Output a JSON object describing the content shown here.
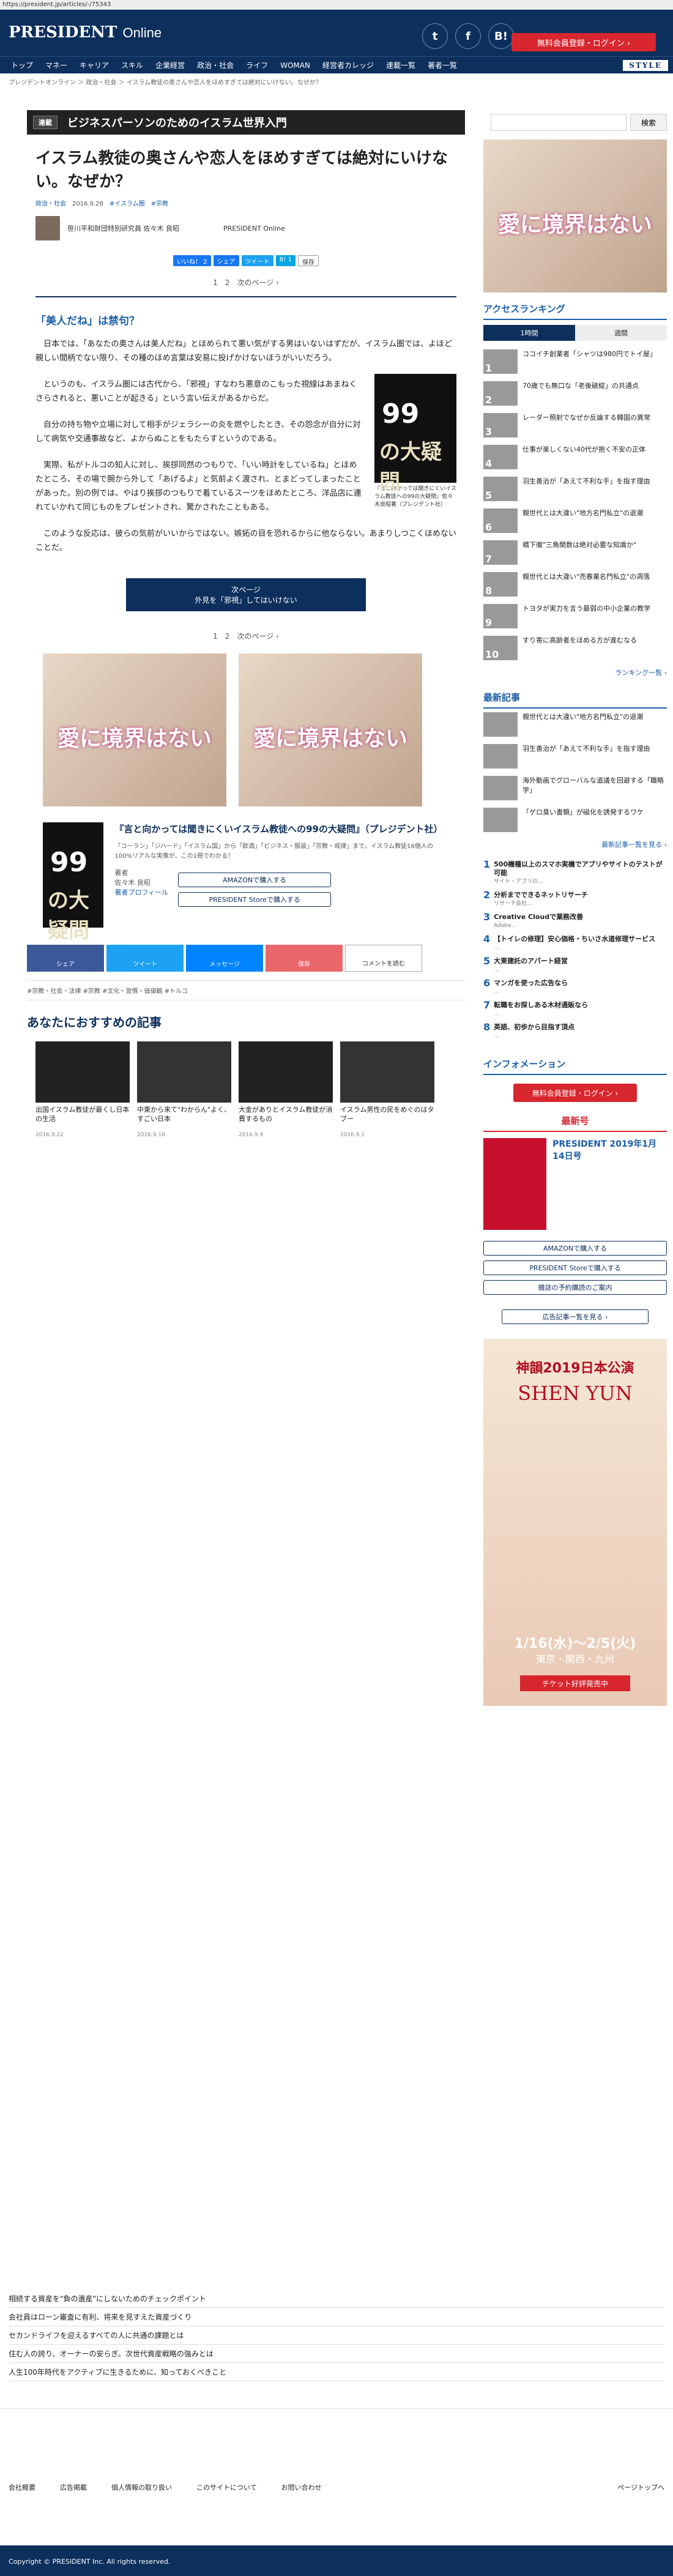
{
  "url": "https://president.jp/articles/-/75343",
  "site": {
    "logo_main": "PRESIDENT",
    "logo_sub": "Online"
  },
  "header": {
    "login_label": "無料会員登録・ログイン ›",
    "icons": [
      "twitter-icon",
      "facebook-icon",
      "hatena-icon"
    ]
  },
  "nav": [
    "トップ",
    "マネー",
    "キャリア",
    "スキル",
    "企業経営",
    "政治・社会",
    "ライフ",
    "WOMAN",
    "経営者カレッジ",
    "連載一覧",
    "著者一覧"
  ],
  "nav_style": "STYLE",
  "breadcrumb": "プレジデントオンライン ＞ 政治・社会 ＞ イスラム教徒の奥さんや恋人をほめすぎては絶対にいけない。なぜか？",
  "series": {
    "tag": "連載",
    "title": "ビジネスパーソンのためのイスラム世界入門"
  },
  "search": {
    "button": "検索"
  },
  "article": {
    "title": "イスラム教徒の奥さんや恋人をほめすぎては絶対にいけない。なぜか？",
    "category": "政治・社会",
    "date": "2016.9.28",
    "tags_inline": "#イスラム圏　#宗教",
    "author": "笹川平和財団特別研究員 佐々木 良昭",
    "publisher": "PRESIDENT Online",
    "share_buttons": [
      "いいね！ 2",
      "シェア",
      "ツイート",
      "B! 1",
      "保存"
    ],
    "pager": "1　2　次のページ ›",
    "subheading": "「美人だね」は禁句？",
    "paragraphs": [
      "日本では、「あなたの奥さんは美人だね」とほめられて悪い気がする男はいないはずだが、イスラム圏では、よほど親しい間柄でない限り、その種のほめ言葉は安易に投げかけないほうがいいだろう。",
      "というのも、イスラム圏には古代から、「邪視」すなわち悪意のこもった視線はあまねくさらされると、悪いことが起きる」という言い伝えがあるからだ。",
      "自分の持ち物や立場に対して相手がジェラシーの炎を燃やしたとき、その怨念が自分に対して病気や交通事故など、よからぬことをもたらすというのである。",
      "実際、私がトルコの知人に対し、挨拶同然のつもりで、「いい時計をしているね」とほめたところ、その場で腕から外して「あげるよ」と気前よく渡され、とまどってしまったことがあった。別の例では、やはり挨拶のつもりで着ているスーツをほめたところ、洋品店に連れていかれて同じものをプレゼントされ、驚かされたこともある。",
      "このような反応は、彼らの気前がいいからではない。嫉妬の目を恐れるからに他ならない。あまりしつこくほめないことだ。"
    ],
    "book_caption": "『言と向かっては聞きにくいイスラム教徒への99の大疑問』佐々木良昭著（プレジデント社）",
    "next": {
      "label": "次ページ",
      "title": "外見を「邪視」してはいけない"
    }
  },
  "ad": {
    "text": "愛に境界はない"
  },
  "book": {
    "title": "『言と向かっては聞きにくいイスラム教徒への99の大疑問』（プレジデント社）",
    "desc": "「コーラン」「ジハード」「イスラム国」から「飲酒」「ビジネス・服装」「宗教・戒律」まで。イスラム教徒16億人の100%リアルな実像が、この1冊でわかる！",
    "author_label": "著者",
    "author": "佐々木 良昭",
    "profile": "著者プロフィール",
    "amazon": "AMAZONで購入する",
    "store": "PRESIDENT Storeで購入する"
  },
  "sharebig": [
    "シェア",
    "ツイート",
    "メッセージ",
    "保存",
    "コメントを読む"
  ],
  "tags": "#宗教・社会・法律 #宗教 #文化・習慣・価値観 #トルコ",
  "recommend_head": "あなたにおすすめの記事",
  "recommend": [
    {
      "title": "出国イスラム教徒が最くし日本の生活",
      "date": "2016.9.22"
    },
    {
      "title": "中東から来て\"わからん\"よく、すごい日本",
      "date": "2016.9.16"
    },
    {
      "title": "大金がありとイスラム教徒が消費するもの",
      "date": "2016.9.9"
    },
    {
      "title": "イスラム男性の民をめぐのはタブー",
      "date": "2016.9.1"
    }
  ],
  "sidebar": {
    "ranking_head": "アクセスランキング",
    "tabs": [
      "1時間",
      "週間"
    ],
    "ranking": [
      "ココイチ創業者「シャツは980円でトイ屋」",
      "70歳でも無口な「老後破綻」の共通点",
      "レーダー照射でなぜか反論する韓国の異常",
      "仕事が楽しくない40代が抱く不安の正体",
      "羽生善治が「あえて不利な手」を指す理由",
      "親世代とは大違い\"地方名門私立\"の退潮",
      "橋下徹\"三角関数は絶対必要な知識か\"",
      "親世代とは大違い\"売春業名門私立\"の凋落",
      "トヨタが実力を言う最弱の中小企業の教学",
      "すり寄に高齢者をほめる方が進むなる"
    ],
    "ranking_more": "ランキング一覧 ›",
    "latest_head": "最新記事",
    "latest": [
      "親世代とは大違い\"地方名門私立\"の退潮",
      "羽生善治が「あえて不利な手」を指す理由",
      "海外動画でグローバルな道議を回避する「職略学」",
      "「ゲロ臭い書類」が磁化を誘発するワケ"
    ],
    "latest_more": "最新記事一覧を見る ›",
    "ads": [
      {
        "t": "500機種以上のスマホ実機でアプリやサイトのテストが可能",
        "s": "サイト・アプリの..."
      },
      {
        "t": "分析までできるネットリサーチ",
        "s": "リサーチ会社..."
      },
      {
        "t": "Creative Cloudで業務改善",
        "s": "Adobe..."
      },
      {
        "t": "【トイレの修理】安心価格・ちいさ水道修理サービス",
        "s": "..."
      },
      {
        "t": "大東建託のアパート経営",
        "s": "..."
      },
      {
        "t": "マンガを使った広告なら",
        "s": "..."
      },
      {
        "t": "転職をお探しある木材通販なら",
        "s": "..."
      },
      {
        "t": "英語、初歩から目指す頂点",
        "s": "..."
      }
    ],
    "info_head": "インフォメーション",
    "login": "無料会員登録・ログイン ›",
    "mag_head": "最新号",
    "mag_title": "PRESIDENT 2019年1月14日号",
    "mag_buttons": [
      "AMAZONで購入する",
      "PRESIDENT Storeで購入する",
      "雑誌の予約購読のご案内"
    ],
    "mag_more": "広告記事一覧を見る ›",
    "shenyun": {
      "title": "神韻2019日本公演",
      "sub": "SHEN YUN",
      "dates": "1/16(水)〜2/5(火)",
      "area": "東京・関西・九州",
      "cta": "チケット好評発売中"
    }
  },
  "footer": {
    "links": [
      "相続する資産を\"負の遺産\"にしないためのチェックポイント",
      "会社員はローン審査に有利、将来を見すえた資産づくり",
      "セカンドライフを迎えるすべての人に共通の課題とは",
      "住む人の誇り、オーナーの安らぎ。次世代資産戦略の強みとは",
      "人生100年時代をアクティブに生きるために、知っておくべきこと"
    ],
    "nav": [
      "会社概要",
      "広告掲載",
      "個人情報の取り扱い",
      "このサイトについて",
      "お問い合わせ"
    ],
    "pagetop": "ページトップへ",
    "copyright": "Copyright © PRESIDENT Inc. All rights reserved."
  }
}
